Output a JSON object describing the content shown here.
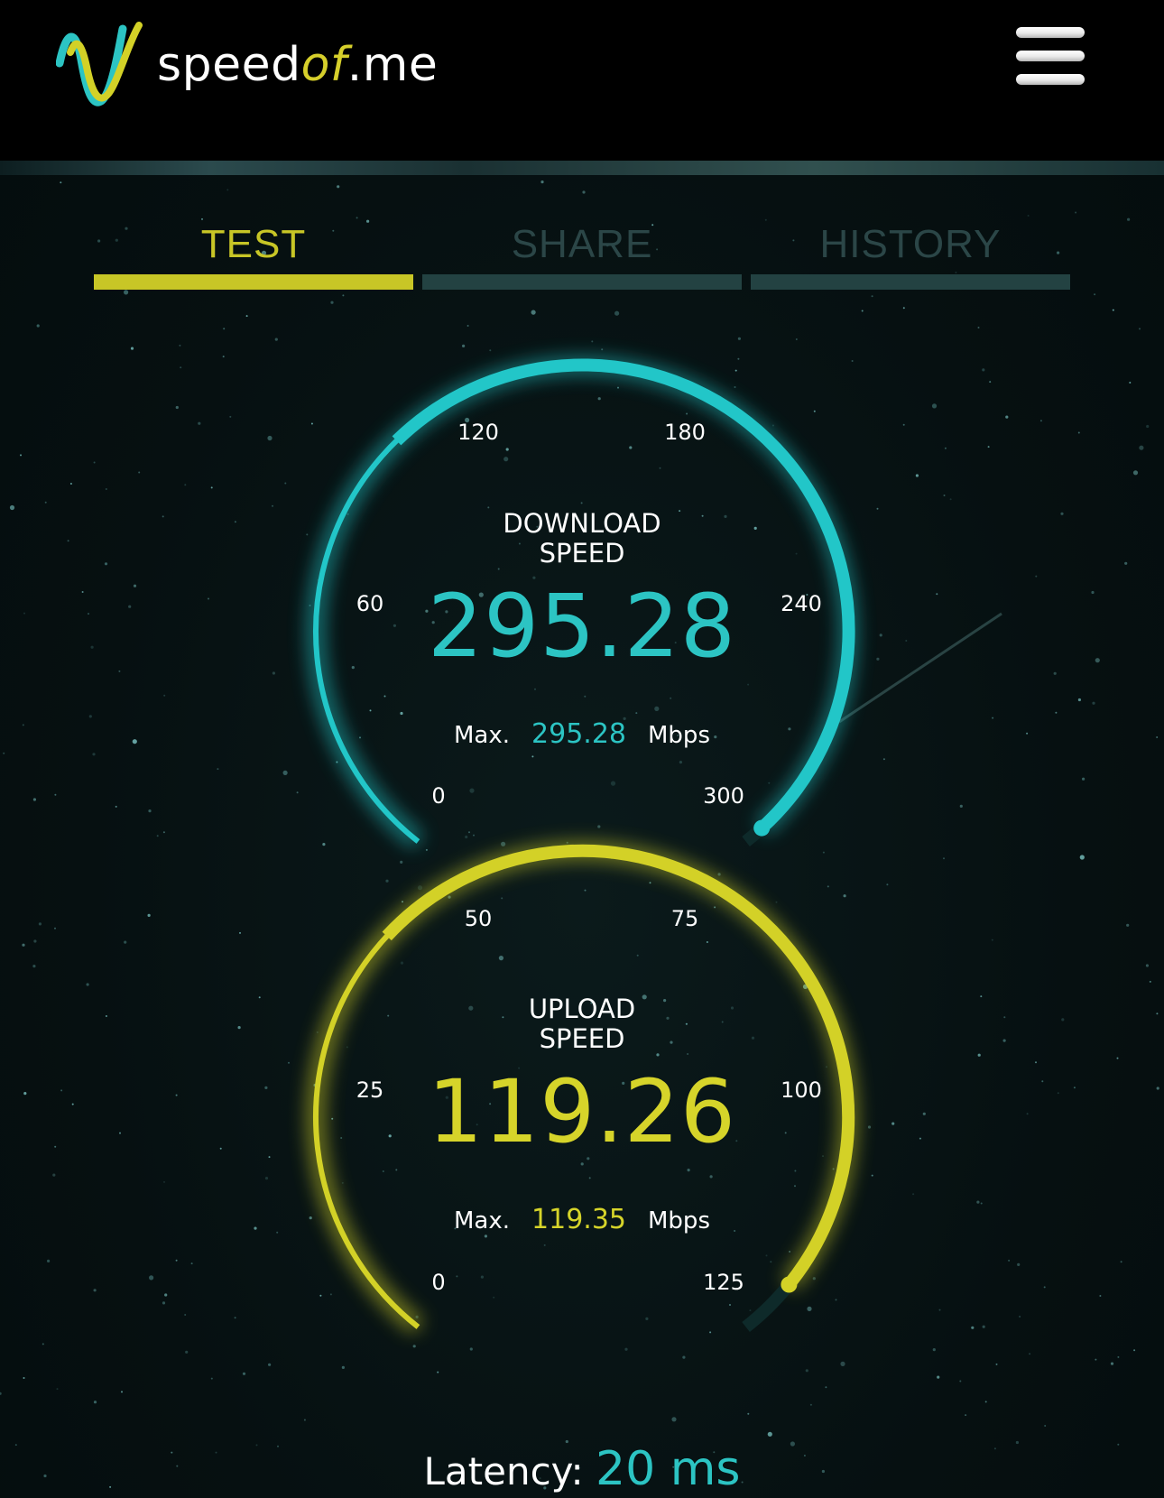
{
  "header": {
    "logo_text_prefix": "speed",
    "logo_text_of": "of",
    "logo_text_suffix": ".me",
    "menu_icon": "hamburger-menu-icon"
  },
  "tabs": [
    {
      "label": "TEST",
      "active": true
    },
    {
      "label": "SHARE",
      "active": false
    },
    {
      "label": "HISTORY",
      "active": false
    }
  ],
  "download": {
    "label_line1": "DOWNLOAD",
    "label_line2": "SPEED",
    "value": "295.28",
    "max_label": "Max.",
    "max_value": "295.28",
    "unit": "Mbps",
    "scale_min": 0,
    "scale_max": 300,
    "current": 295.28,
    "ticks": [
      "0",
      "60",
      "120",
      "180",
      "240",
      "300"
    ],
    "color": "#22c6c8"
  },
  "upload": {
    "label_line1": "UPLOAD",
    "label_line2": "SPEED",
    "value": "119.26",
    "max_label": "Max.",
    "max_value": "119.35",
    "unit": "Mbps",
    "scale_min": 0,
    "scale_max": 125,
    "current": 119.26,
    "ticks": [
      "0",
      "25",
      "50",
      "75",
      "100",
      "125"
    ],
    "color": "#d3d127"
  },
  "latency": {
    "label": "Latency:",
    "value": "20 ms"
  },
  "colors": {
    "accent_yellow": "#c8c626",
    "accent_cyan": "#2cc4c3",
    "tab_inactive": "#234242"
  }
}
